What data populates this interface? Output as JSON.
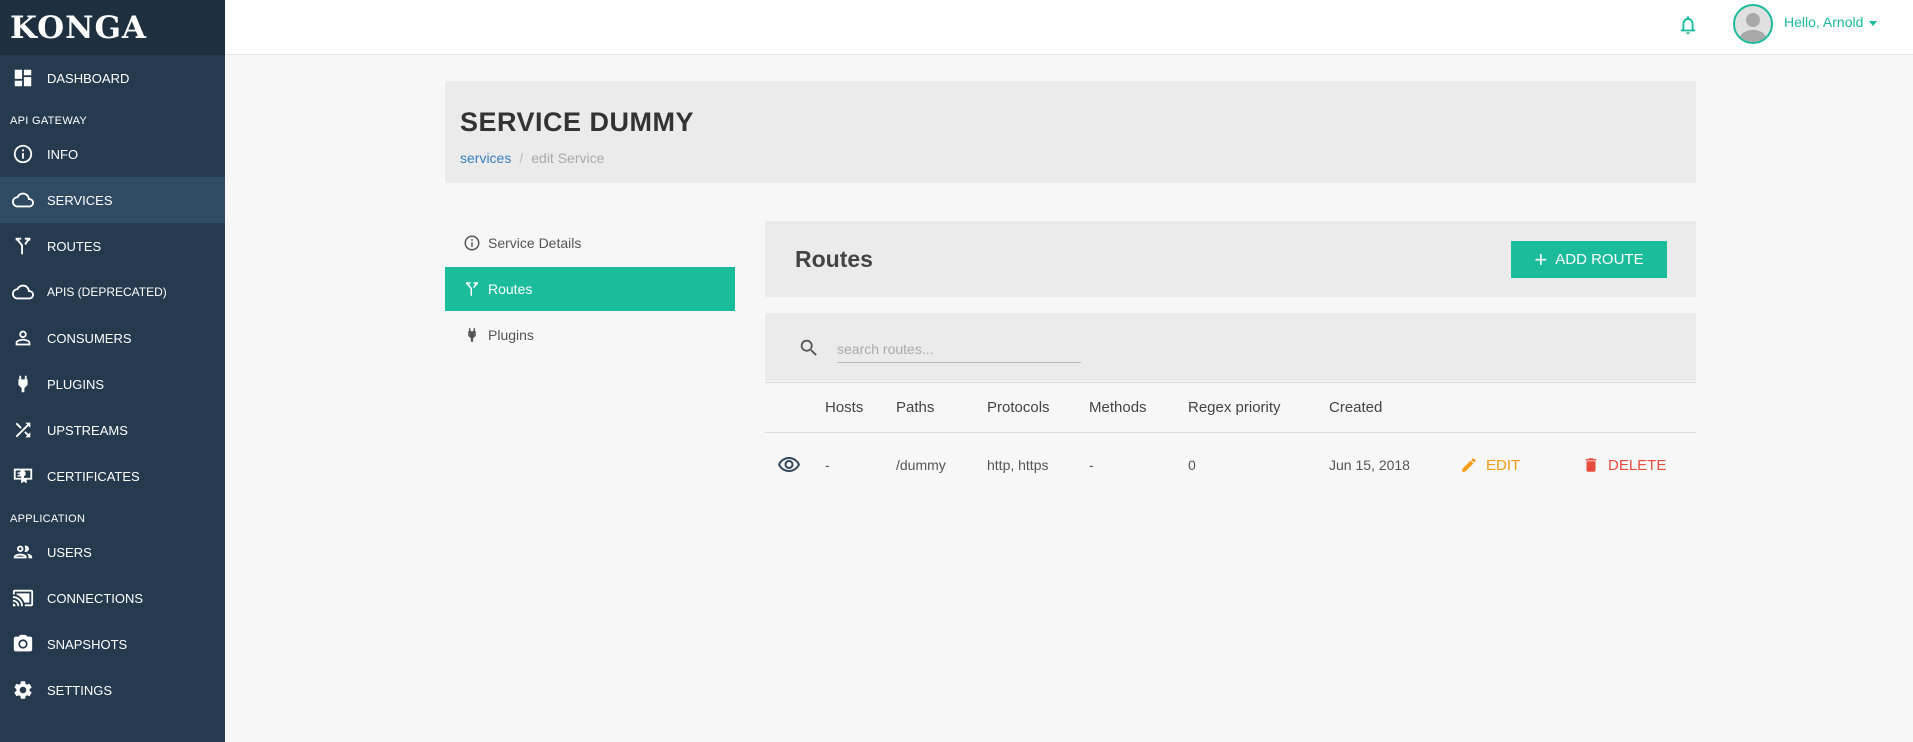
{
  "app": {
    "logo": "KONGA"
  },
  "sidebar": {
    "dashboard": "DASHBOARD",
    "section_api": "API GATEWAY",
    "info": "INFO",
    "services": "SERVICES",
    "routes": "ROUTES",
    "apis": "APIS (DEPRECATED)",
    "consumers": "CONSUMERS",
    "plugins": "PLUGINS",
    "upstreams": "UPSTREAMS",
    "certificates": "CERTIFICATES",
    "section_app": "APPLICATION",
    "users": "USERS",
    "connections": "CONNECTIONS",
    "snapshots": "SNAPSHOTS",
    "settings": "SETTINGS"
  },
  "topbar": {
    "greeting": "Hello, Arnold"
  },
  "header": {
    "title": "SERVICE DUMMY",
    "breadcrumb_link": "services",
    "breadcrumb_sep": "/",
    "breadcrumb_current": "edit Service"
  },
  "tabs": {
    "details": "Service Details",
    "routes": "Routes",
    "plugins": "Plugins"
  },
  "routes": {
    "title": "Routes",
    "add_button": "ADD ROUTE",
    "search_placeholder": "search routes...",
    "columns": {
      "hosts": "Hosts",
      "paths": "Paths",
      "protocols": "Protocols",
      "methods": "Methods",
      "regex": "Regex priority",
      "created": "Created"
    },
    "rows": [
      {
        "hosts": "-",
        "paths": "/dummy",
        "protocols": "http, https",
        "methods": "-",
        "regex": "0",
        "created": "Jun 15, 2018",
        "edit": "EDIT",
        "delete": "DELETE"
      }
    ]
  },
  "colors": {
    "accent": "#1abc9c",
    "sidebar": "#263a4f",
    "edit": "#f39c12",
    "delete": "#e74c3c"
  }
}
